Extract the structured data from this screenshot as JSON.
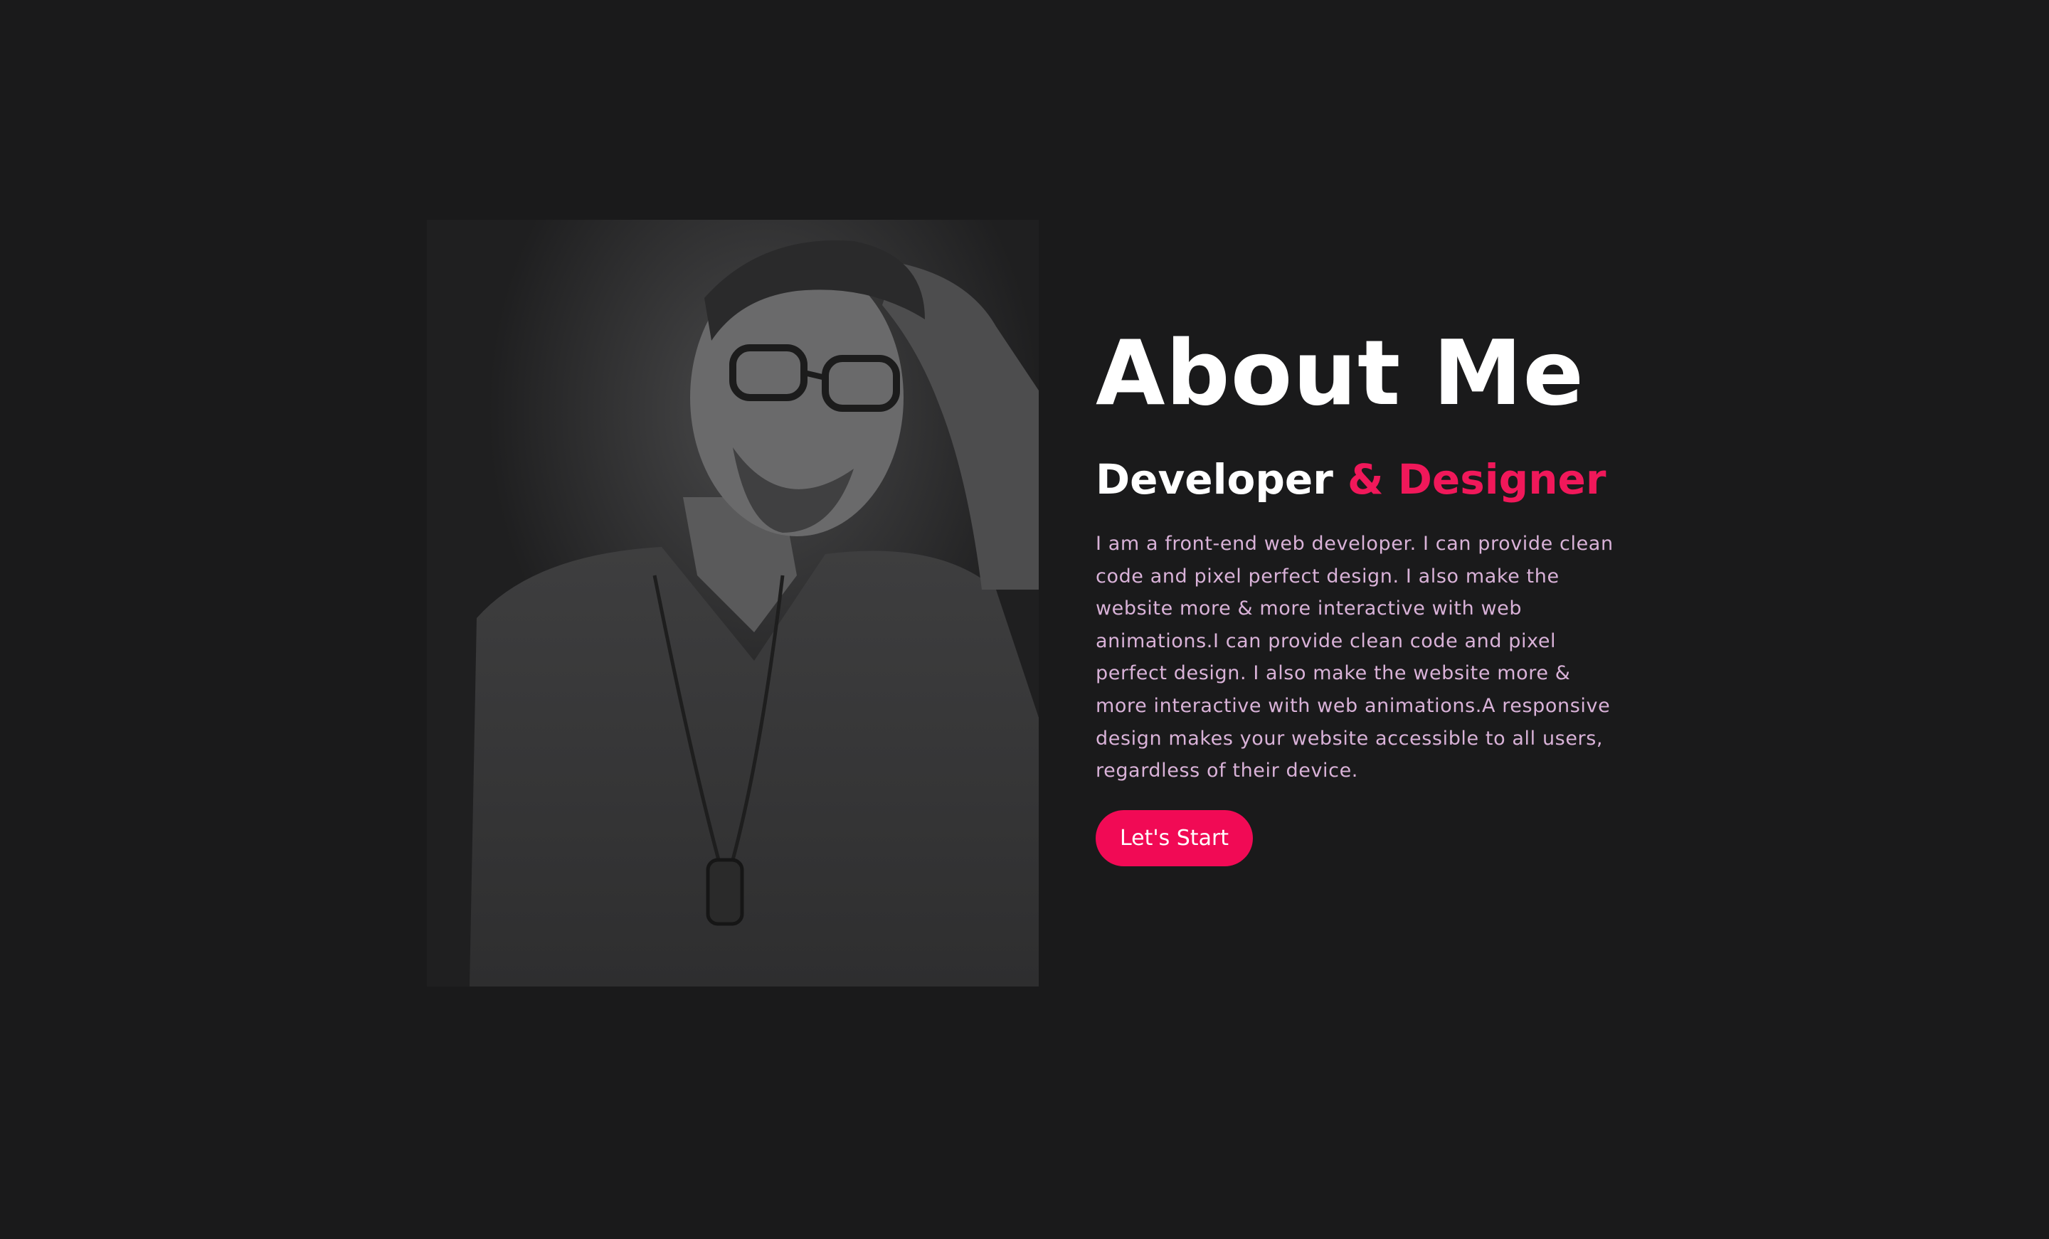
{
  "about": {
    "title": "About Me",
    "subtitle_main": "Developer",
    "subtitle_accent": "& Designer",
    "description": "I am a front-end web developer. I can provide clean code and pixel perfect design. I also make the website more & more interactive with web animations.I can provide clean code and pixel perfect design. I also make the website more & more interactive with web animations.A responsive design makes your website accessible to all users, regardless of their device.",
    "button_label": "Let's Start"
  },
  "theme": {
    "background": "#1a1a1b",
    "accent": "#f10a55",
    "text_primary": "#ffffff",
    "text_body": "#d9b2d8"
  },
  "images": {
    "portrait": "black-and-white portrait photo"
  }
}
